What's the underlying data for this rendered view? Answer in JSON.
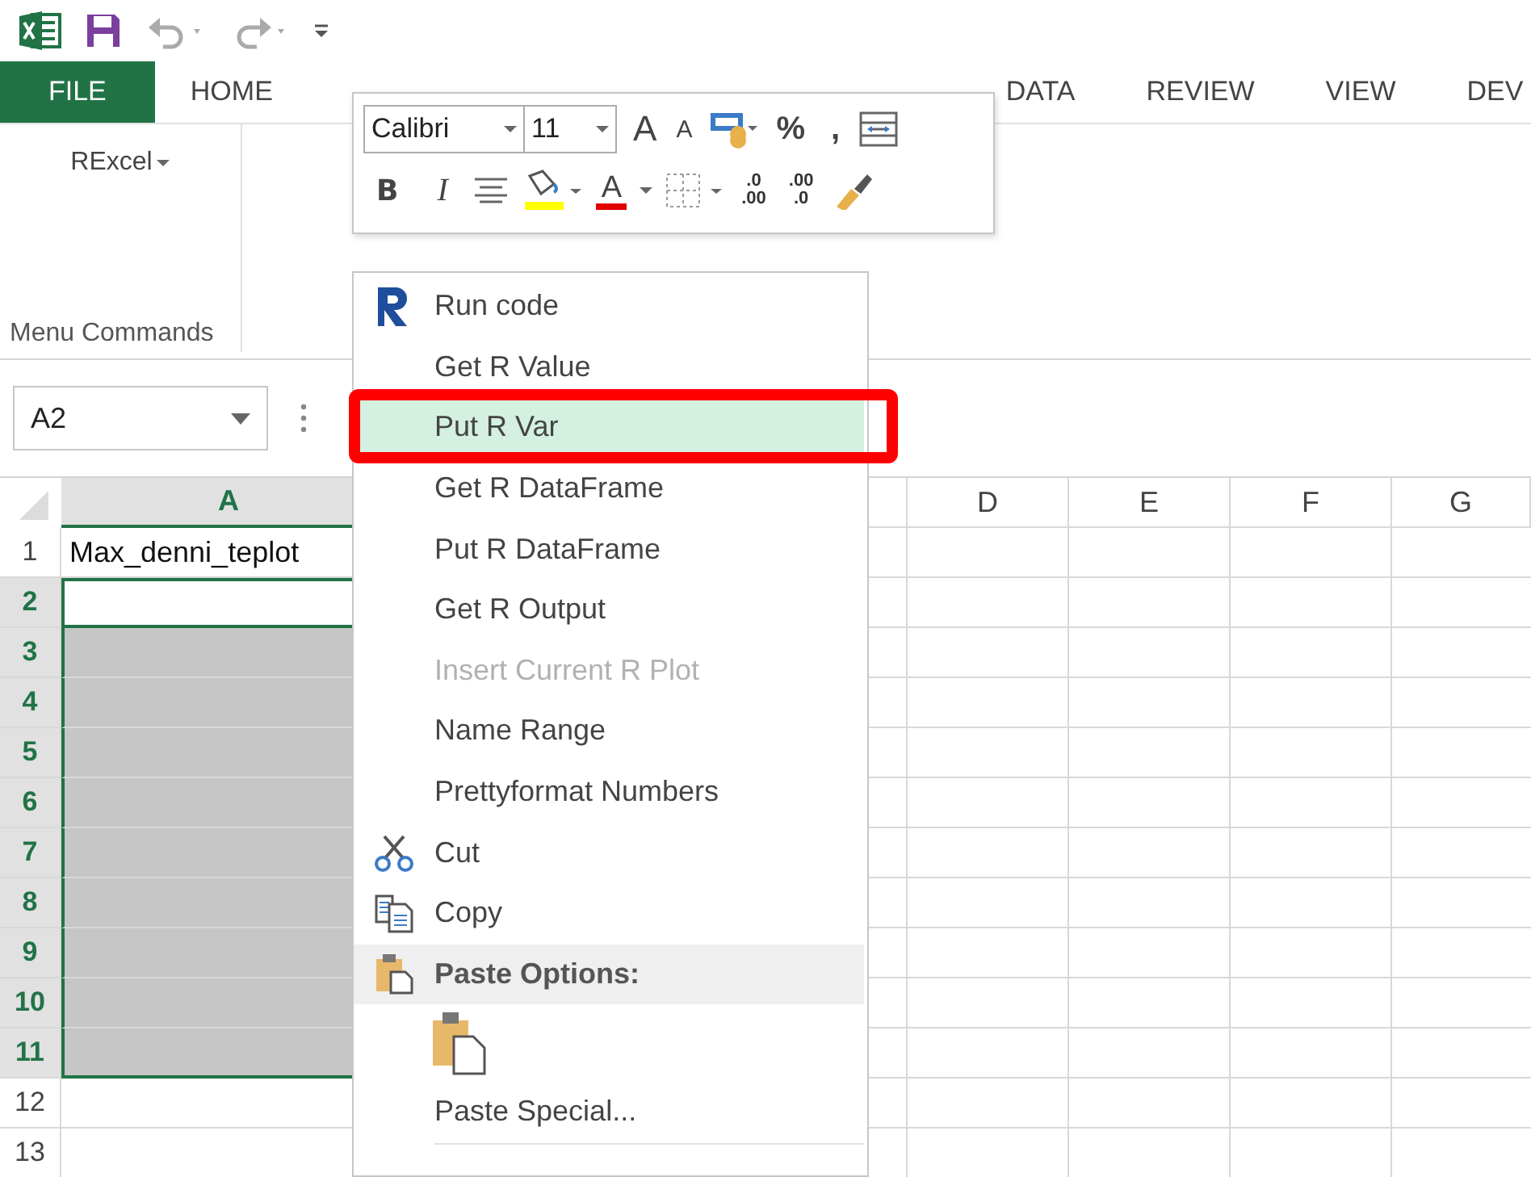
{
  "tabs": [
    {
      "label": "FILE",
      "kind": "file"
    },
    {
      "label": "HOME",
      "kind": "tab"
    },
    {
      "label": "DATA",
      "kind": "tab"
    },
    {
      "label": "REVIEW",
      "kind": "tab"
    },
    {
      "label": "VIEW",
      "kind": "tab"
    },
    {
      "label": "DEV",
      "kind": "tab"
    }
  ],
  "ribbon": {
    "group_button": "RExcel",
    "group_label": "Menu Commands"
  },
  "name_box": {
    "value": "A2"
  },
  "mini_toolbar": {
    "font": "Calibri",
    "size": "11",
    "grow": "A",
    "shrink": "A",
    "percent": "%",
    "comma": ",",
    "bold": "B",
    "italic": "I",
    "font_color": "A",
    "increase_decimal": {
      "top": ".0",
      "bottom": ".00"
    },
    "decrease_decimal": {
      "top": ".00",
      "bottom": ".0"
    }
  },
  "sheet": {
    "columns": [
      {
        "label": "A",
        "selected": true
      },
      {
        "label": "D",
        "selected": false
      },
      {
        "label": "E",
        "selected": false
      },
      {
        "label": "F",
        "selected": false
      },
      {
        "label": "G",
        "selected": false
      }
    ],
    "rows": [
      {
        "label": "1",
        "selected": false,
        "in_range": false,
        "cell": "Max_denni_teplot"
      },
      {
        "label": "2",
        "selected": true,
        "in_range": false
      },
      {
        "label": "3",
        "selected": true,
        "in_range": true
      },
      {
        "label": "4",
        "selected": true,
        "in_range": true
      },
      {
        "label": "5",
        "selected": true,
        "in_range": true
      },
      {
        "label": "6",
        "selected": true,
        "in_range": true
      },
      {
        "label": "7",
        "selected": true,
        "in_range": true
      },
      {
        "label": "8",
        "selected": true,
        "in_range": true
      },
      {
        "label": "9",
        "selected": true,
        "in_range": true
      },
      {
        "label": "10",
        "selected": true,
        "in_range": true
      },
      {
        "label": "11",
        "selected": true,
        "in_range": true
      },
      {
        "label": "12",
        "selected": false,
        "in_range": false
      },
      {
        "label": "13",
        "selected": false,
        "in_range": false
      }
    ]
  },
  "context_menu": {
    "items": [
      {
        "label": "Run code",
        "kind": "logo",
        "disabled": false,
        "selected": false,
        "framed": false
      },
      {
        "label": "Get R Value",
        "kind": "plain",
        "disabled": false,
        "selected": false,
        "framed": false
      },
      {
        "label": "Put R Var",
        "kind": "plain",
        "disabled": false,
        "selected": true,
        "framed": true
      },
      {
        "label": "Get R DataFrame",
        "kind": "plain",
        "disabled": false,
        "selected": false,
        "framed": false
      },
      {
        "label": "Put R DataFrame",
        "kind": "plain",
        "disabled": false,
        "selected": false,
        "framed": false
      },
      {
        "label": "Get R Output",
        "kind": "plain",
        "disabled": false,
        "selected": false,
        "framed": false
      },
      {
        "label": "Insert Current R Plot",
        "kind": "plain",
        "disabled": true,
        "selected": false,
        "framed": false
      },
      {
        "label": "Name Range",
        "kind": "plain",
        "disabled": false,
        "selected": false,
        "framed": false
      },
      {
        "label": "Prettyformat Numbers",
        "kind": "plain",
        "disabled": false,
        "selected": false,
        "framed": false
      },
      {
        "label": "Cut",
        "kind": "scissors",
        "disabled": false,
        "selected": false,
        "framed": false
      },
      {
        "label": "Copy",
        "kind": "copy",
        "disabled": false,
        "selected": false,
        "framed": false
      },
      {
        "label": "Paste Options:",
        "kind": "header"
      },
      {
        "kind": "paste_option"
      },
      {
        "label": "Paste Special...",
        "kind": "separated",
        "disabled": false,
        "selected": false,
        "framed": false
      }
    ]
  }
}
